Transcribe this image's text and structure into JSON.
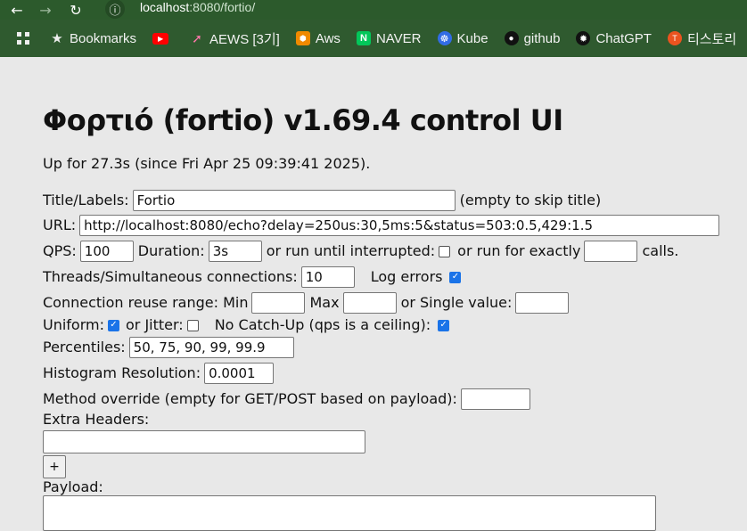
{
  "browser": {
    "url_host": "localhost",
    "url_rest": ":8080/fortio/",
    "bookmarks": [
      {
        "label": "Bookmarks",
        "icon": "star-icon"
      },
      {
        "label": "",
        "icon": "youtube-icon"
      },
      {
        "label": "AEWS [3기]",
        "icon": "rocket-icon"
      },
      {
        "label": "Aws",
        "icon": "aws-icon"
      },
      {
        "label": "NAVER",
        "icon": "naver-icon"
      },
      {
        "label": "Kube",
        "icon": "kubernetes-icon"
      },
      {
        "label": "github",
        "icon": "github-icon"
      },
      {
        "label": "ChatGPT",
        "icon": "chatgpt-icon"
      },
      {
        "label": "티스토리",
        "icon": "tistory-icon"
      }
    ]
  },
  "page": {
    "title": "Φορτιό (fortio) v1.69.4 control UI",
    "uptime": "Up for 27.3s (since Fri Apr 25 09:39:41 2025).",
    "title_label": "Title/Labels:",
    "title_value": "Fortio",
    "title_hint": "(empty to skip title)",
    "url_label": "URL:",
    "url_value": "http://localhost:8080/echo?delay=250us:30,5ms:5&status=503:0.5,429:1.5",
    "qps_label": "QPS:",
    "qps_value": "100",
    "duration_label": "Duration:",
    "duration_value": "3s",
    "interrupt_label": "or run until interrupted:",
    "exact_label": "or run for exactly",
    "calls_label": "calls.",
    "threads_label": "Threads/Simultaneous connections:",
    "threads_value": "10",
    "log_errors_label": "Log errors",
    "reuse_label": "Connection reuse range: Min",
    "max_label": "Max",
    "single_label": "or Single value:",
    "uniform_label": "Uniform:",
    "jitter_label": "or Jitter:",
    "catchup_label": "No Catch-Up (qps is a ceiling):",
    "percentiles_label": "Percentiles:",
    "percentiles_value": "50, 75, 90, 99, 99.9",
    "histogram_label": "Histogram Resolution:",
    "histogram_value": "0.0001",
    "method_label": "Method override (empty for GET/POST based on payload):",
    "extra_headers_label": "Extra Headers:",
    "plus_label": "+",
    "payload_label": "Payload:"
  }
}
